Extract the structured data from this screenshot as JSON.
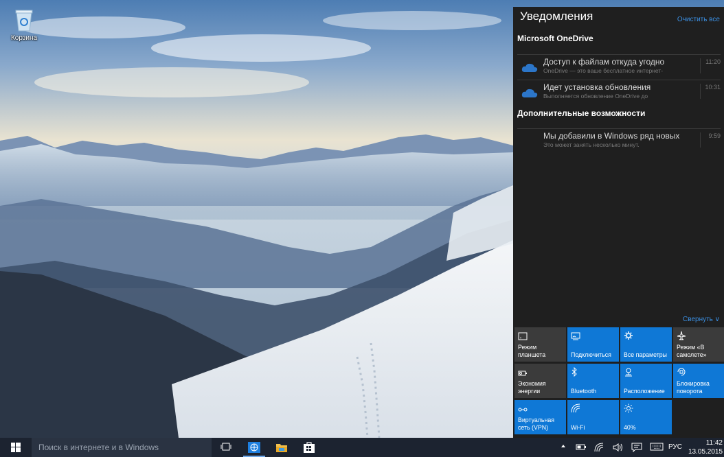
{
  "desktop": {
    "recycle_bin_label": "Корзина"
  },
  "action_center": {
    "title": "Уведомления",
    "clear_all": "Очистить все",
    "collapse": "Свернуть ∨",
    "groups": [
      {
        "name": "Microsoft OneDrive",
        "items": [
          {
            "title": "Доступ к файлам откуда угодно",
            "body": "OneDrive — это ваше бесплатное интернет-",
            "time": "11:20",
            "icon": "onedrive-cloud-icon"
          },
          {
            "title": "Идет установка обновления",
            "body": "Выполняется обновление OneDrive до",
            "time": "10:31",
            "icon": "onedrive-cloud-icon"
          }
        ]
      },
      {
        "name": "Дополнительные возможности",
        "items": [
          {
            "title": "Мы добавили в Windows ряд новых",
            "body": "Это может занять несколько минут.",
            "time": "9:59"
          }
        ]
      }
    ],
    "quick_actions": [
      {
        "label": "Режим планшета",
        "state": "off",
        "icon": "tablet-mode-icon"
      },
      {
        "label": "Подключиться",
        "state": "on",
        "icon": "connect-icon"
      },
      {
        "label": "Все параметры",
        "state": "on",
        "icon": "settings-gear-icon"
      },
      {
        "label": "Режим «В самолете»",
        "state": "off",
        "icon": "airplane-icon"
      },
      {
        "label": "Экономия энергии",
        "state": "off",
        "icon": "battery-saver-icon"
      },
      {
        "label": "Bluetooth",
        "state": "on",
        "icon": "bluetooth-icon"
      },
      {
        "label": "Расположение",
        "state": "on",
        "icon": "location-icon"
      },
      {
        "label": "Блокировка поворота",
        "state": "on",
        "icon": "rotation-lock-icon"
      },
      {
        "label": "Виртуальная сеть (VPN)",
        "state": "on",
        "icon": "vpn-icon"
      },
      {
        "label": "Wi-Fi",
        "state": "on",
        "icon": "wifi-icon"
      },
      {
        "label": "40%",
        "state": "on",
        "icon": "brightness-icon"
      }
    ]
  },
  "taskbar": {
    "search_placeholder": "Поиск в интернете и в Windows",
    "language": "РУС",
    "time": "11:42",
    "date": "13.05.2015"
  },
  "colors": {
    "accent": "#0f78d6",
    "panel_bg": "#1f1f1f",
    "tile_off": "#3b3b3b",
    "taskbar_bg": "#1c2330",
    "link": "#3b8ee0"
  }
}
